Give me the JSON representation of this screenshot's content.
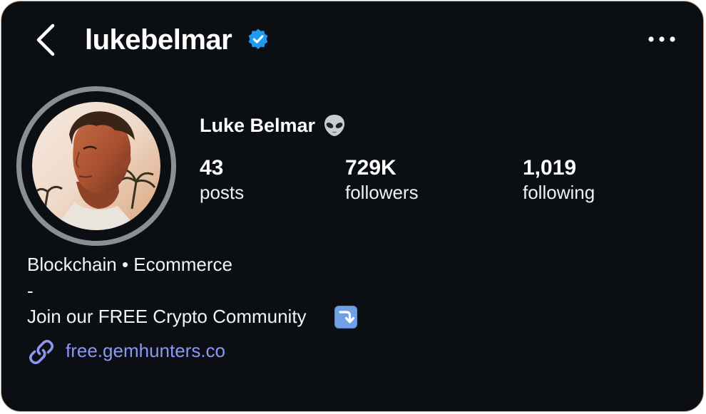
{
  "header": {
    "username": "lukebelmar",
    "back_icon": "chevron-left-icon",
    "verified_icon": "verified-badge-icon",
    "more_icon": "more-horizontal-icon",
    "verified_color": "#1d9bf0"
  },
  "profile": {
    "display_name": "Luke Belmar",
    "name_emoji": "alien-emoji",
    "avatar_ring_color": "#8a8f96"
  },
  "stats": [
    {
      "value": "43",
      "label": "posts"
    },
    {
      "value": "729K",
      "label": "followers"
    },
    {
      "value": "1,019",
      "label": "following"
    }
  ],
  "bio": {
    "line1": "Blockchain • Ecommerce",
    "line2": "-",
    "line3": "Join our FREE Crypto Community",
    "line3_emoji": "arrow-down-right-emoji"
  },
  "link": {
    "icon": "link-icon",
    "text": "free.gemhunters.co",
    "color": "#8c97f5"
  },
  "theme": {
    "background": "#0b0f14",
    "border": "#c9a27e"
  }
}
